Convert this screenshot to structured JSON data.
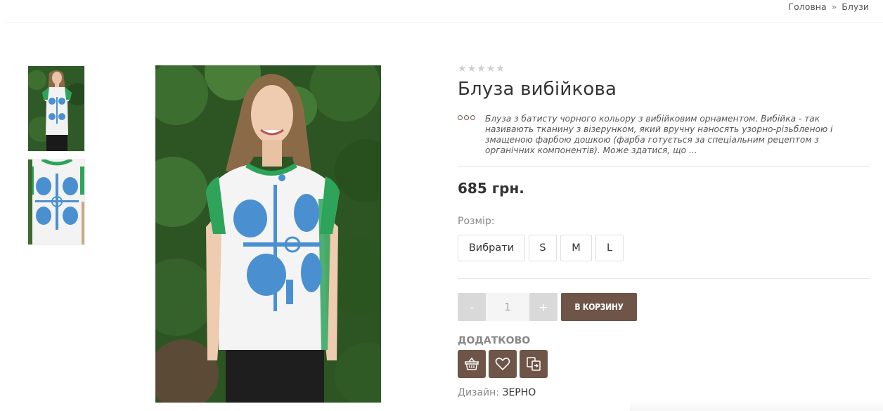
{
  "breadcrumb": {
    "home": "Головна",
    "separator": "»",
    "current": "Блузи"
  },
  "product": {
    "rating_stars": 5,
    "rating_value": 0,
    "title": "Блуза вибійкова",
    "description": "Блуза з батисту чорного кольору з вибійковим орнаментом. Вибійка - так називають тканину з візерунком, який вручну наносять узорно-різьбленою і змащеною фарбою дошкою (фарба готується за спеціальним рецептом з органічних компонентів). Може здатися, що ...",
    "price": "685 грн.",
    "size_label": "Розмір:",
    "sizes": [
      "Вибрати",
      "S",
      "M",
      "L"
    ],
    "qty_minus": "-",
    "qty_value": "1",
    "qty_plus": "+",
    "add_to_cart": "В КОРЗИНУ",
    "extra_label": "ДОДАТКОВО",
    "extra_icons": [
      "basket-icon",
      "heart-icon",
      "compare-icon"
    ],
    "design_label": "Дизайн:",
    "design_value": "ЗЕРНО"
  },
  "colors": {
    "accent_brown": "#6e5547",
    "shirt_green": "#2ea35a",
    "ornament_blue": "#4a90d0"
  }
}
